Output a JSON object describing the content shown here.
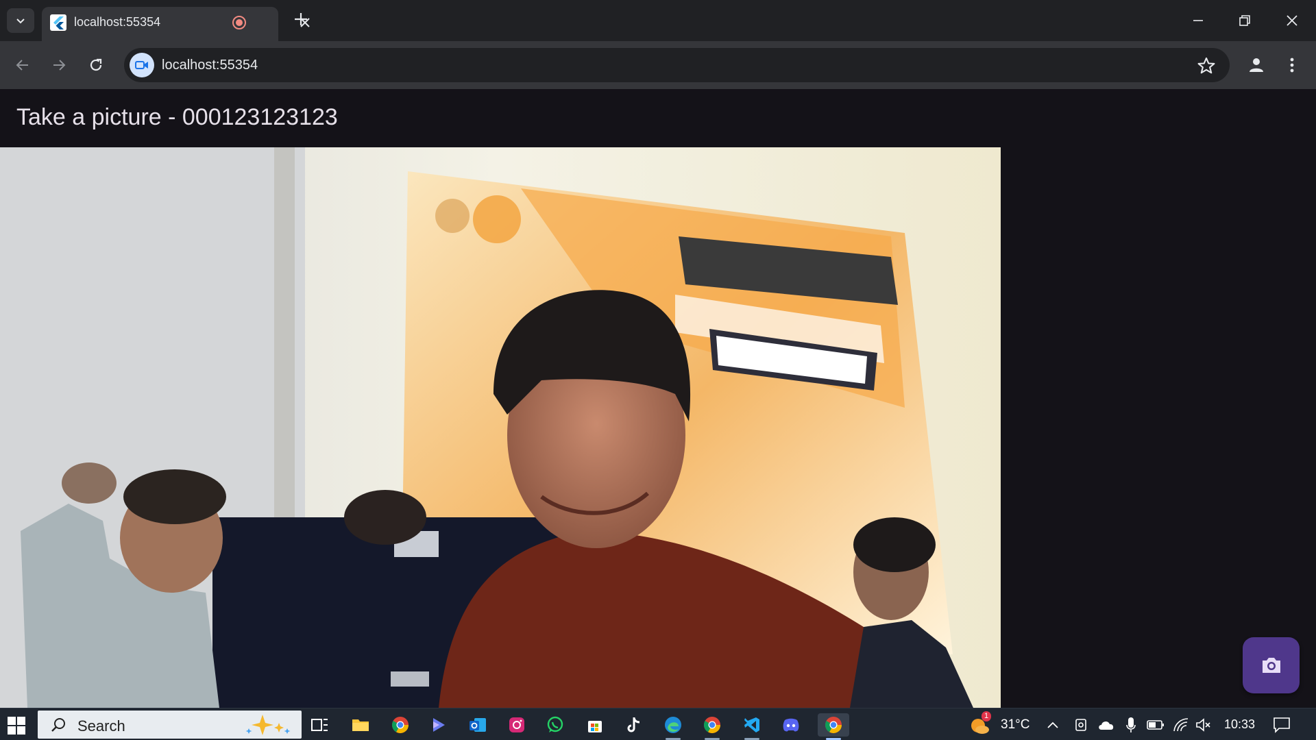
{
  "browser": {
    "tab_title": "localhost:55354",
    "url": "localhost:55354"
  },
  "page": {
    "title": "Take a picture - 000123123123"
  },
  "taskbar": {
    "search_label": "Search",
    "temperature": "31°C",
    "time": "10:33",
    "weather_badge": "1"
  },
  "icons": {
    "capture": "camera-icon",
    "star": "star-icon",
    "profile": "account-icon"
  },
  "colors": {
    "page_background": "#141218",
    "fab": "#4f378b",
    "title_text": "#e6e0e9"
  }
}
